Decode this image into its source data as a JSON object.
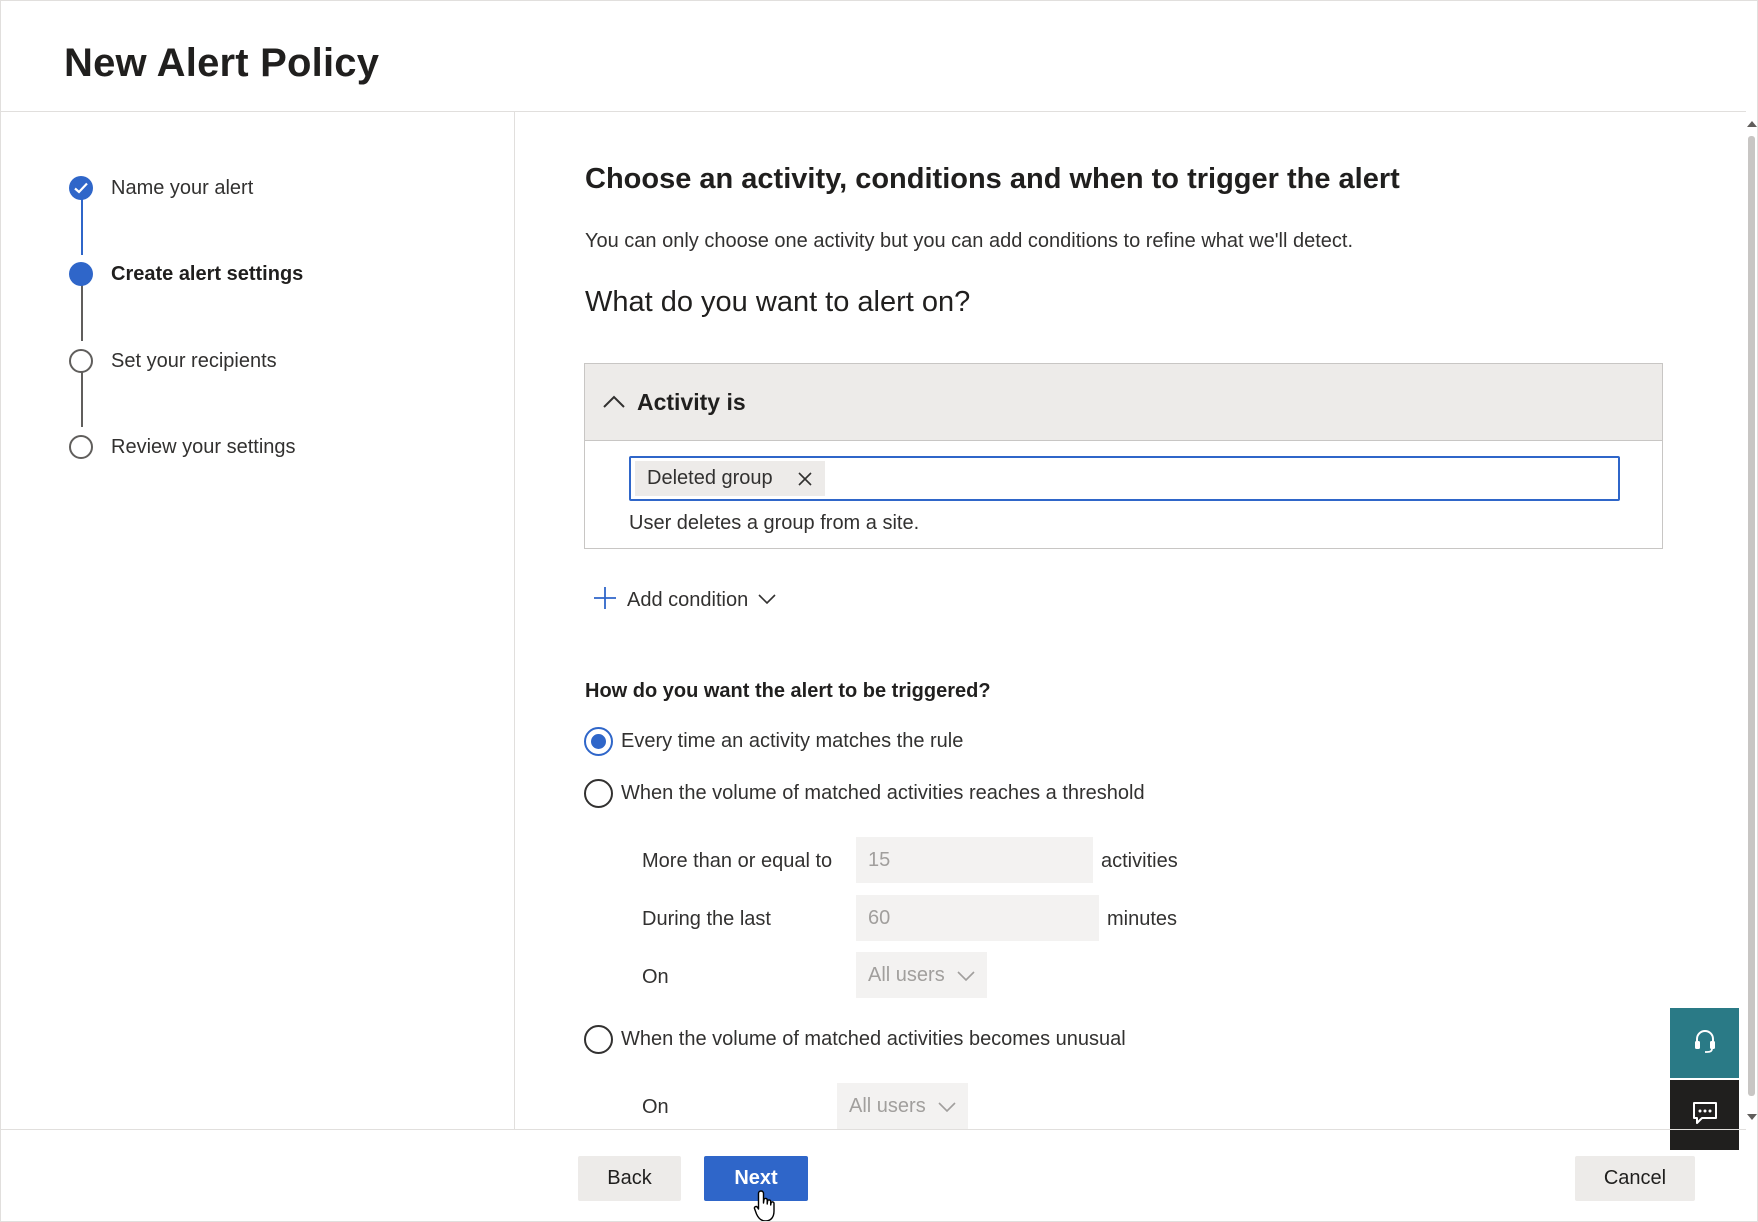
{
  "page": {
    "title": "New Alert Policy"
  },
  "stepper": {
    "steps": [
      {
        "label": "Name your alert",
        "state": "completed"
      },
      {
        "label": "Create alert settings",
        "state": "current"
      },
      {
        "label": "Set your recipients",
        "state": "upcoming"
      },
      {
        "label": "Review your settings",
        "state": "upcoming"
      }
    ]
  },
  "main": {
    "heading": "Choose an activity, conditions and when to trigger the alert",
    "description": "You can only choose one activity but you can add conditions to refine what we'll detect.",
    "subheading": "What do you want to alert on?",
    "activity": {
      "header": "Activity is",
      "tag": "Deleted group",
      "hint": "User deletes a group from a site."
    },
    "add_condition_label": "Add condition",
    "trigger": {
      "question": "How do you want the alert to be triggered?",
      "options": [
        {
          "label": "Every time an activity matches the rule",
          "checked": true
        },
        {
          "label": "When the volume of matched activities reaches a threshold",
          "checked": false
        },
        {
          "label": "When the volume of matched activities becomes unusual",
          "checked": false
        }
      ],
      "threshold": {
        "more_than_label": "More than or equal to",
        "more_than_value": "15",
        "more_than_unit": "activities",
        "during_label": "During the last",
        "during_value": "60",
        "during_unit": "minutes",
        "on_label": "On",
        "on_value": "All users"
      },
      "unusual": {
        "on_label": "On",
        "on_value": "All users"
      }
    }
  },
  "footer": {
    "back_label": "Back",
    "next_label": "Next",
    "cancel_label": "Cancel"
  },
  "icons": {
    "step_completed": "checkmark-icon",
    "collapse": "chevron-up-icon",
    "remove_tag": "close-icon",
    "add": "plus-icon",
    "dropdown": "chevron-down-icon",
    "help": "headset-icon",
    "feedback": "feedback-icon",
    "pointer": "hand-cursor-icon"
  },
  "colors": {
    "accent": "#2f66c9",
    "help_button": "#2a7a86",
    "feedback_button": "#201f1e"
  }
}
